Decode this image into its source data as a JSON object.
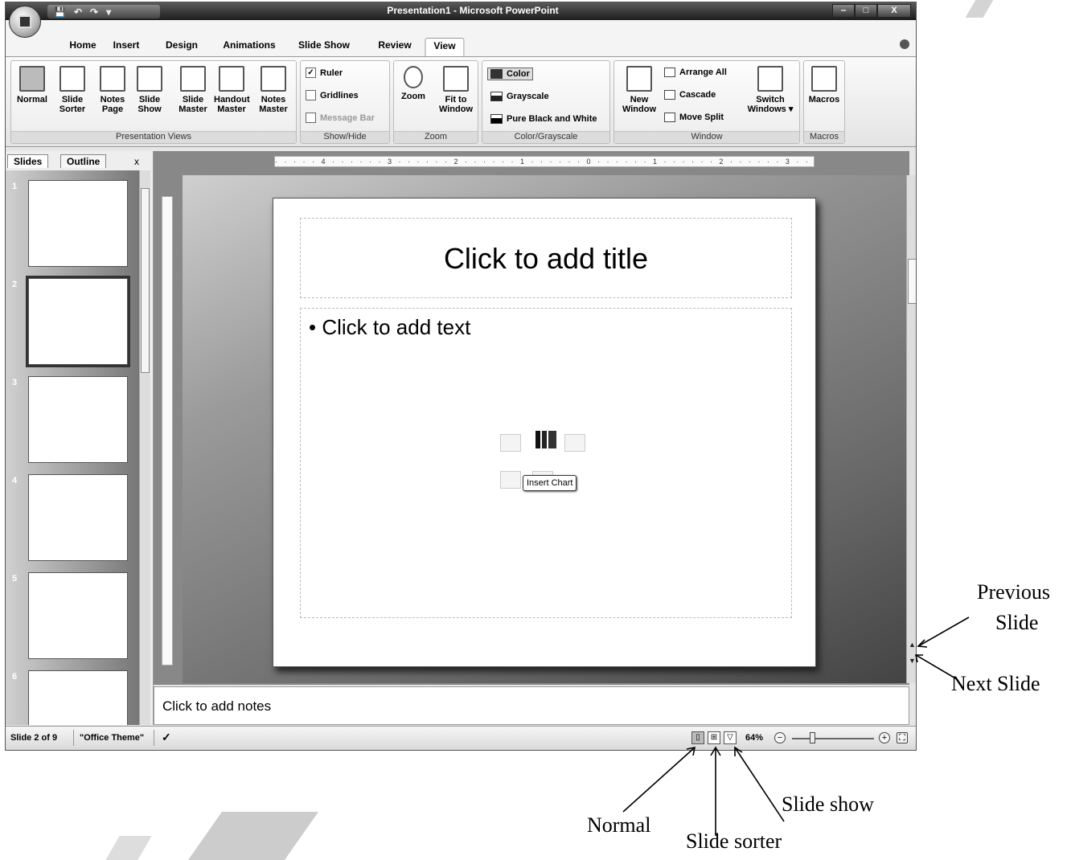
{
  "window": {
    "title": "Presentation1 - Microsoft PowerPoint",
    "quick_access": [
      "💾",
      "↶",
      "↷",
      "▾"
    ],
    "controls": [
      "‒",
      "□",
      "X"
    ]
  },
  "ribbon_tabs": [
    "Home",
    "Insert",
    "Design",
    "Animations",
    "Slide Show",
    "Review",
    "View"
  ],
  "ribbon": {
    "presentation_views": {
      "label": "Presentation Views",
      "buttons": [
        "Normal",
        "Slide Sorter",
        "Notes Page",
        "Slide Show",
        "Slide Master",
        "Handout Master",
        "Notes Master"
      ]
    },
    "show_hide": {
      "label": "Show/Hide",
      "ruler": "Ruler",
      "gridlines": "Gridlines",
      "message_bar": "Message Bar"
    },
    "zoom": {
      "label": "Zoom",
      "zoom": "Zoom",
      "fit": "Fit to Window"
    },
    "color": {
      "label": "Color/Grayscale",
      "color": "Color",
      "grayscale": "Grayscale",
      "pbw": "Pure Black and White"
    },
    "window": {
      "label": "Window",
      "new_window": "New Window",
      "arrange_all": "Arrange All",
      "cascade": "Cascade",
      "move_split": "Move Split",
      "switch": "Switch Windows ▾"
    },
    "macros": {
      "label": "Macros",
      "macros": "Macros"
    }
  },
  "panel": {
    "tabs": [
      "Slides",
      "Outline"
    ],
    "close": "x",
    "thumbnails": [
      "1",
      "2",
      "3",
      "4",
      "5",
      "6"
    ],
    "selected": "2"
  },
  "ruler": {
    "horizontal": "· · · · · 4 · · · · · · 3 · · · · · · 2 · · · · · · 1 · · · · · · 0 · · · · · · 1 · · · · · · 2 · · · · · · 3 · · · · · · 4 · · · · · ·"
  },
  "slide": {
    "title_placeholder": "Click to add title",
    "body_placeholder": "• Click to add text",
    "tooltip": "Insert Chart"
  },
  "notes": {
    "placeholder": "Click to add notes"
  },
  "statusbar": {
    "slide": "Slide 2 of 9",
    "theme": "\"Office Theme\"",
    "zoom": "64%",
    "zoom_level_percent": 64
  },
  "annotations": {
    "previous_slide_1": "Previous",
    "previous_slide_2": "Slide",
    "next_slide": "Next Slide",
    "normal": "Normal",
    "slide_sorter": "Slide sorter",
    "slide_show": "Slide show"
  }
}
